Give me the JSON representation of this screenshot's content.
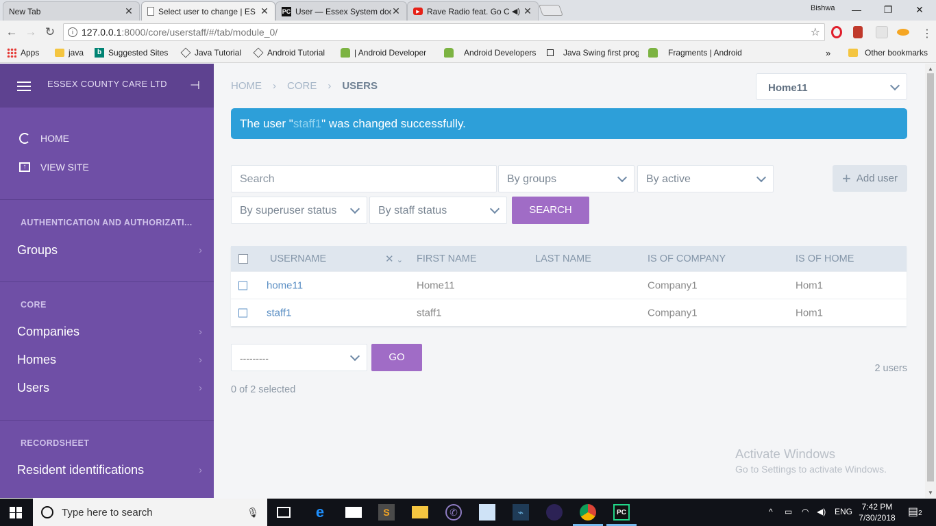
{
  "browser": {
    "tabs": [
      {
        "title": "New Tab",
        "active": false
      },
      {
        "title": "Select user to change | ES",
        "active": true
      },
      {
        "title": "User — Essex System doc",
        "active": false
      },
      {
        "title": "Rave Radio feat. Go C",
        "active": false
      }
    ],
    "profile_name": "Bishwa",
    "url_host": "127.0.0.1",
    "url_path": ":8000/core/userstaff/#/tab/module_0/",
    "bookmarks": [
      "Apps",
      "java",
      "Suggested Sites",
      "Java Tutorial",
      "Android Tutorial",
      "| Android Developer",
      "Android Developers",
      "Java Swing first prog",
      "Fragments | Android"
    ],
    "bookmarks_overflow": "»",
    "other_bookmarks": "Other bookmarks"
  },
  "sidebar": {
    "brand": "ESSEX COUNTY CARE LTD",
    "links": [
      {
        "label": "HOME",
        "icon": "circle-icon"
      },
      {
        "label": "VIEW SITE",
        "icon": "open-in-new-icon"
      }
    ],
    "sections": [
      {
        "title": "AUTHENTICATION AND AUTHORIZATI...",
        "items": [
          "Groups"
        ]
      },
      {
        "title": "CORE",
        "items": [
          "Companies",
          "Homes",
          "Users"
        ]
      },
      {
        "title": "RECORDSHEET",
        "items": [
          "Resident identifications"
        ]
      }
    ]
  },
  "main": {
    "breadcrumb": [
      "HOME",
      "CORE",
      "USERS"
    ],
    "home_select": "Home11",
    "message": {
      "prefix": "The user \"",
      "username": "staff1",
      "suffix": "\" was changed successfully."
    },
    "search_placeholder": "Search",
    "filters": {
      "groups": "By groups",
      "active": "By active",
      "superuser": "By superuser status",
      "staff": "By staff status"
    },
    "search_button": "SEARCH",
    "add_button": "Add user",
    "table": {
      "columns": [
        "USERNAME",
        "FIRST NAME",
        "LAST NAME",
        "IS OF COMPANY",
        "IS OF HOME"
      ],
      "rows": [
        {
          "username": "home11",
          "first_name": "Home11",
          "last_name": "",
          "company": "Company1",
          "home": "Hom1"
        },
        {
          "username": "staff1",
          "first_name": "staff1",
          "last_name": "",
          "company": "Company1",
          "home": "Hom1"
        }
      ]
    },
    "action_select": "---------",
    "go_button": "GO",
    "count": "2 users",
    "selected": "0 of 2 selected",
    "watermark_title": "Activate Windows",
    "watermark_sub": "Go to Settings to activate Windows."
  },
  "taskbar": {
    "search_placeholder": "Type here to search",
    "language": "ENG",
    "time": "7:42 PM",
    "date": "7/30/2018",
    "notifications": "2"
  },
  "colors": {
    "sidebar": "#6f4fa6",
    "accent_purple": "#a06cc6",
    "message_blue": "#2d9fd9"
  }
}
